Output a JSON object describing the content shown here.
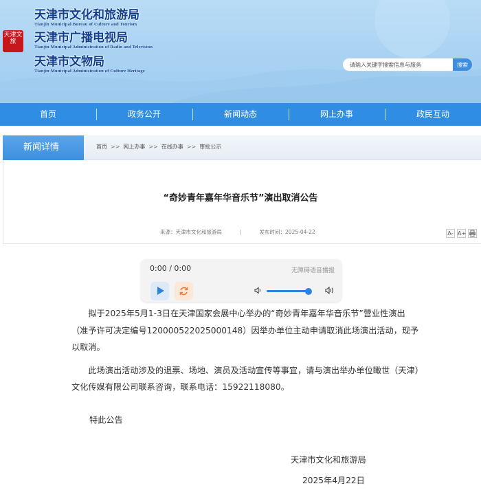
{
  "header": {
    "emblem_text": "天津文旅",
    "orgs": [
      {
        "cn": "天津市文化和旅游局",
        "en": "Tianjin Municipal Bureau of Culture and Tourism"
      },
      {
        "cn": "天津市广播电视局",
        "en": "Tianjin Municipal Administration of Radio and Television"
      },
      {
        "cn": "天津市文物局",
        "en": "Tianjin Municipal Administration of Culture Heritage"
      }
    ],
    "search": {
      "placeholder": "请输入关键字搜索信息与服务",
      "button": "搜索"
    },
    "colors": {
      "nav": "#2f8ee4",
      "header_bg": "#a9d2f2",
      "title_text": "#123f8e"
    }
  },
  "nav": {
    "items": [
      "首页",
      "政务公开",
      "新闻动态",
      "网上办事",
      "政民互动"
    ]
  },
  "crumbs": {
    "tab": "新闻详情",
    "items": [
      "首页",
      "网上办事",
      "在线办事",
      "审批公示"
    ],
    "sep": ">>"
  },
  "article": {
    "title": "“奇妙青年嘉年华音乐节”演出取消公告",
    "source": "来源：天津市文化和旅游局",
    "date": "发布时间：2025-04-22",
    "font_tools": [
      "A-",
      "A+",
      "print-icon"
    ],
    "paragraphs": [
      "拟于2025年5月1-3日在天津国家会展中心举办的“奇妙青年嘉年华音乐节”营业性演出（准予许可决定编号120000522025000148）因举办单位主动申请取消此场演出活动，现予以取消。",
      "此场演出活动涉及的退票、场地、演员及活动宣传等事宜，请与演出举办单位瞰世（天津）文化传媒有限公司联系咨询，联系电话：15922118080。"
    ],
    "closing": "特此公告",
    "sign_org": "天津市文化和旅游局",
    "sign_date": "2025年4月22日"
  },
  "player": {
    "time": "0:00 / 0:00",
    "label": "无障碍语音播报",
    "volume": 0.95
  }
}
